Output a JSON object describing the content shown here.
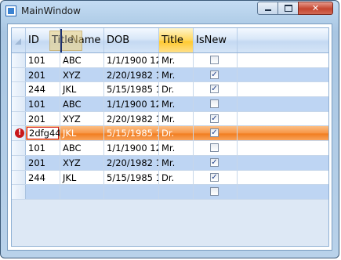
{
  "window": {
    "title": "MainWindow"
  },
  "grid": {
    "columns": [
      "ID",
      "Name",
      "DOB",
      "Title",
      "IsNew"
    ],
    "drag_ghost_label": "Title",
    "rows": [
      {
        "id": "101",
        "name": "ABC",
        "dob": "1/1/1900 12",
        "title": "Mr.",
        "is_new": false
      },
      {
        "id": "201",
        "name": "XYZ",
        "dob": "2/20/1982 1",
        "title": "Mr.",
        "is_new": true
      },
      {
        "id": "244",
        "name": "JKL",
        "dob": "5/15/1985 1",
        "title": "Dr.",
        "is_new": true
      },
      {
        "id": "101",
        "name": "ABC",
        "dob": "1/1/1900 12",
        "title": "Mr.",
        "is_new": false
      },
      {
        "id": "201",
        "name": "XYZ",
        "dob": "2/20/1982 1",
        "title": "Mr.",
        "is_new": true
      },
      {
        "id": "2dfg44",
        "name": "JKL",
        "dob": "5/15/1985 1",
        "title": "Dr.",
        "is_new": true
      },
      {
        "id": "101",
        "name": "ABC",
        "dob": "1/1/1900 12",
        "title": "Mr.",
        "is_new": false
      },
      {
        "id": "201",
        "name": "XYZ",
        "dob": "2/20/1982 1",
        "title": "Mr.",
        "is_new": true
      },
      {
        "id": "244",
        "name": "JKL",
        "dob": "5/15/1985 1",
        "title": "Dr.",
        "is_new": true
      }
    ],
    "error_marker": "!",
    "check_glyph": "✓"
  }
}
